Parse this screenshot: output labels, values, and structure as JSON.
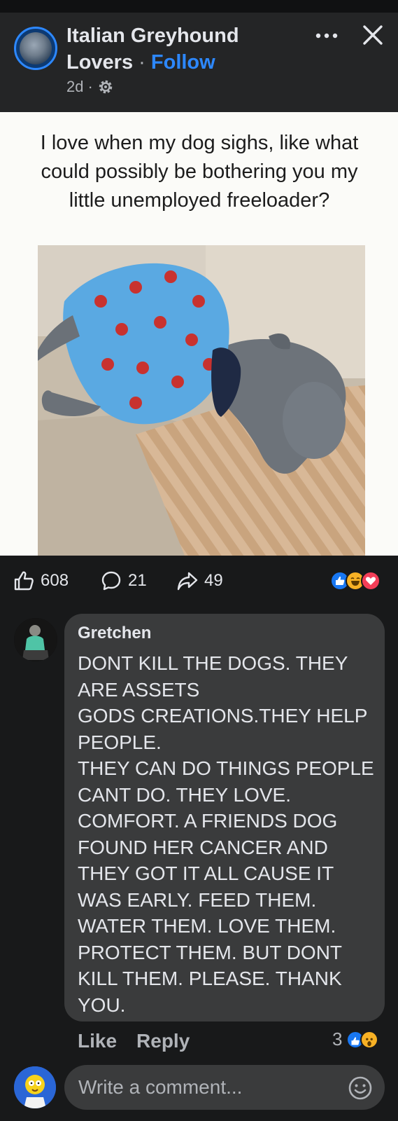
{
  "post": {
    "group_name": "Italian Greyhound Lovers",
    "separator": " · ",
    "follow_label": "Follow",
    "time": "2d",
    "meta_separator": "·",
    "meme_caption": "I love when my dog sighs, like what could possibly be bothering you my little unemployed freeloader?"
  },
  "stats": {
    "likes": "608",
    "comments": "21",
    "shares": "49"
  },
  "comment": {
    "author": "Gretchen",
    "text": "DONT KILL THE DOGS. THEY ARE ASSETS\n GODS CREATIONS.THEY HELP PEOPLE.\nTHEY CAN DO THINGS PEOPLE CANT DO. THEY LOVE. COMFORT. A FRIENDS DOG FOUND HER CANCER AND THEY GOT IT ALL CAUSE IT WAS EARLY. FEED THEM. WATER THEM. LOVE THEM. PROTECT THEM. BUT DONT KILL THEM. PLEASE. THANK YOU.",
    "like_label": "Like",
    "reply_label": "Reply",
    "reaction_count": "3"
  },
  "composer": {
    "placeholder": "Write a comment..."
  },
  "colors": {
    "accent": "#2d88ff",
    "surface": "#242526",
    "bubble": "#3a3b3c",
    "background": "#18191a"
  },
  "icons": {
    "more": "more-dots-icon",
    "close": "close-icon",
    "settings": "gear-icon",
    "like": "thumbs-up-icon",
    "comment": "comment-bubble-icon",
    "share": "share-arrow-icon",
    "emoji": "emoji-icon"
  }
}
